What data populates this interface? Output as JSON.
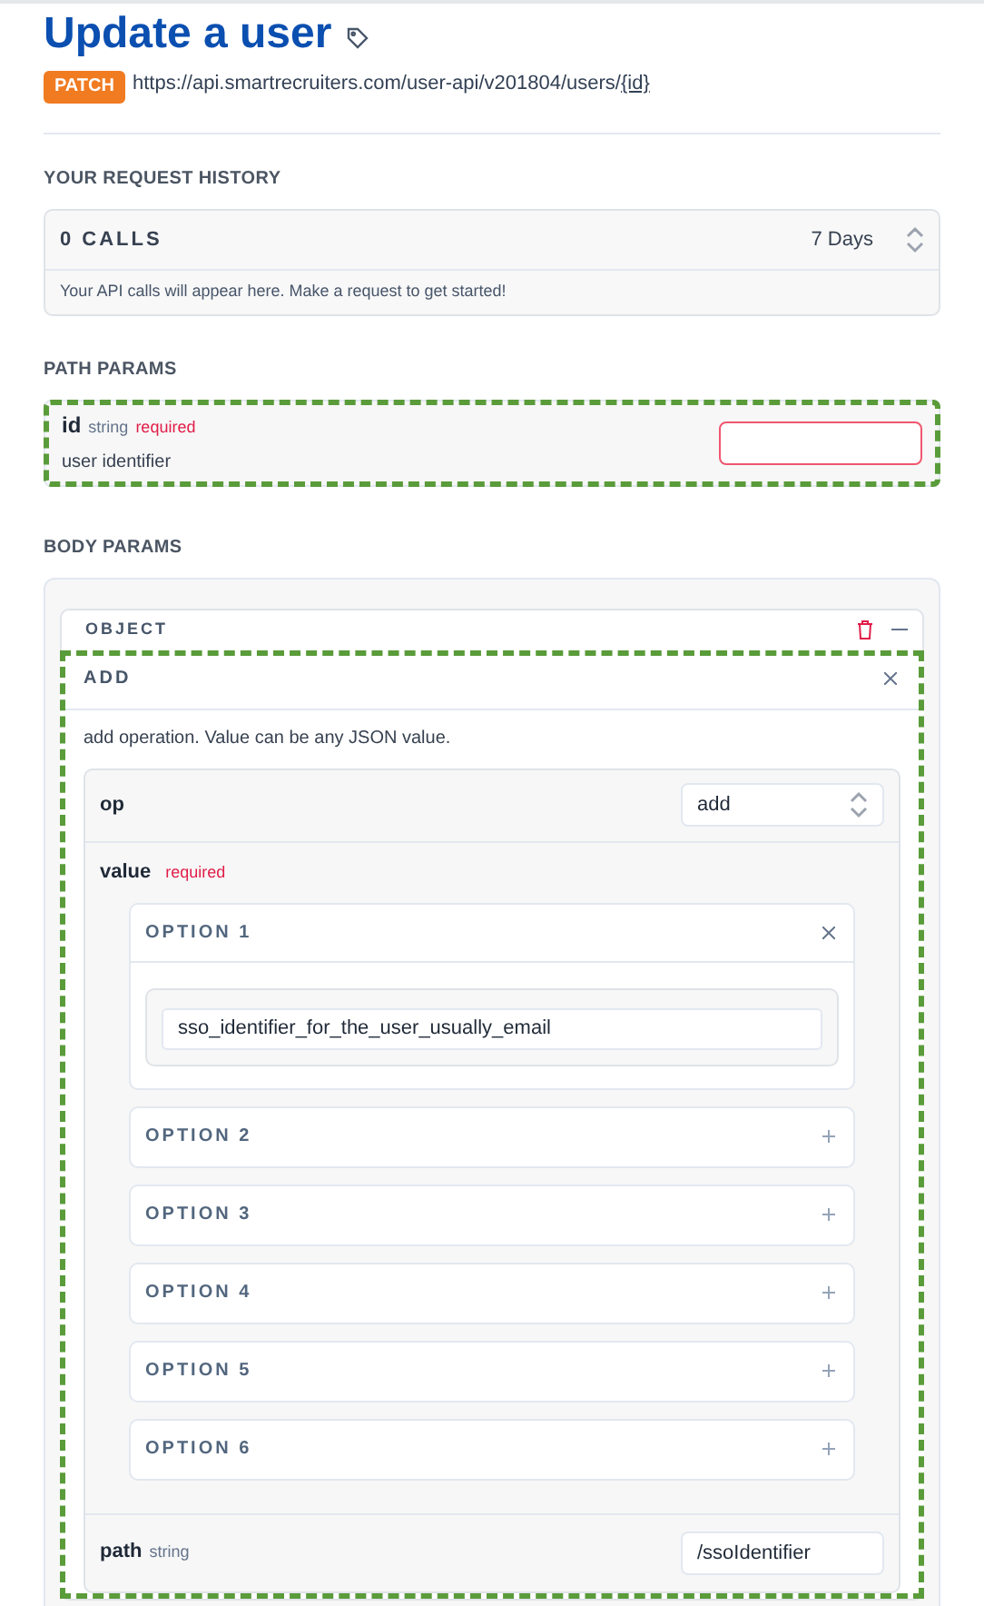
{
  "title": "Update a user",
  "method": "PATCH",
  "url": "https://api.smartrecruiters.com/user-api/v201804/users/",
  "url_param": "{id}",
  "request_history": {
    "heading": "YOUR REQUEST HISTORY",
    "calls": "0 CALLS",
    "range": "7 Days",
    "message": "Your API calls will appear here. Make a request to get started!"
  },
  "path_params": {
    "heading": "PATH PARAMS",
    "highlighted": true,
    "name": "id",
    "type": "string",
    "required": "required",
    "description": "user identifier",
    "invalid": true
  },
  "body_params": {
    "heading": "BODY PARAMS",
    "object": {
      "label": "OBJECT",
      "add": {
        "label": "ADD",
        "highlighted": true,
        "description": "add operation. Value can be any JSON value.",
        "op": {
          "name": "op",
          "value": "add"
        },
        "value": {
          "name": "value",
          "required": "required",
          "options": [
            {
              "label": "OPTION 1",
              "expanded": true,
              "value": "sso_identifier_for_the_user_usually_email"
            },
            {
              "label": "OPTION 2",
              "expanded": false
            },
            {
              "label": "OPTION 3",
              "expanded": false
            },
            {
              "label": "OPTION 4",
              "expanded": false
            },
            {
              "label": "OPTION 5",
              "expanded": false
            },
            {
              "label": "OPTION 6",
              "expanded": false
            }
          ]
        },
        "path": {
          "name": "path",
          "type": "string",
          "value": "/ssoIdentifier"
        }
      }
    }
  }
}
